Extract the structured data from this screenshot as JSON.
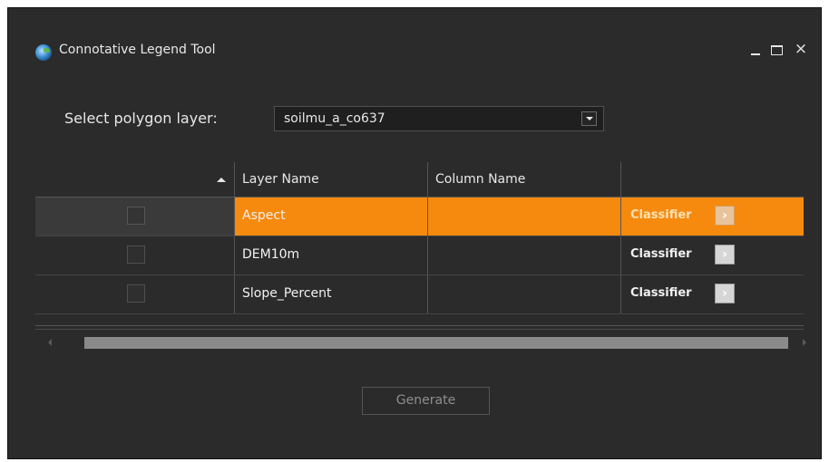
{
  "window": {
    "title": "Connotative Legend Tool",
    "icon": "globe-search-icon",
    "controls": {
      "minimize": "_",
      "maximize": "□",
      "close": "×"
    }
  },
  "form": {
    "select_label": "Select polygon layer:",
    "selected_layer": "soilmu_a_co637"
  },
  "table": {
    "headers": [
      "",
      "Layer Name",
      "Column Name",
      ""
    ],
    "sort_indicator": "up-triangle",
    "rows": [
      {
        "checked": false,
        "layer": "Aspect",
        "column": "",
        "action": "Classifier",
        "selected": true
      },
      {
        "checked": false,
        "layer": "DEM10m",
        "column": "",
        "action": "Classifier",
        "selected": false
      },
      {
        "checked": false,
        "layer": "Slope_Percent",
        "column": "",
        "action": "Classifier",
        "selected": false
      }
    ]
  },
  "footer": {
    "generate_label": "Generate"
  },
  "colors": {
    "background": "#2b2b2b",
    "selection": "#f68a0e",
    "text": "#e8e8e8"
  }
}
